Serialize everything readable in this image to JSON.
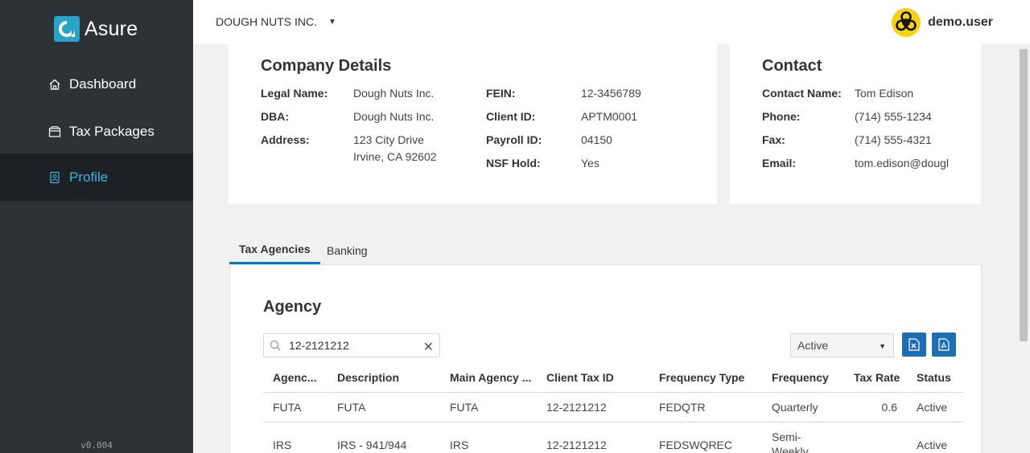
{
  "sidebar": {
    "brand": "Asure",
    "items": [
      {
        "label": "Dashboard",
        "icon": "home-icon"
      },
      {
        "label": "Tax Packages",
        "icon": "package-icon"
      },
      {
        "label": "Profile",
        "icon": "profile-icon"
      }
    ],
    "active_item": "Profile",
    "version": "v0.004"
  },
  "header": {
    "company": "DOUGH NUTS INC.",
    "username": "demo.user",
    "avatar_icon": "biohazard-icon"
  },
  "company_details": {
    "title": "Company Details",
    "legal_name_label": "Legal Name:",
    "legal_name": "Dough Nuts Inc.",
    "dba_label": "DBA:",
    "dba": "Dough Nuts Inc.",
    "address_label": "Address:",
    "address_line1": "123 City Drive",
    "address_line2": "Irvine, CA 92602",
    "fein_label": "FEIN:",
    "fein": "12-3456789",
    "client_id_label": "Client ID:",
    "client_id": "APTM0001",
    "payroll_id_label": "Payroll ID:",
    "payroll_id": "04150",
    "nsf_hold_label": "NSF Hold:",
    "nsf_hold": "Yes"
  },
  "contact": {
    "title": "Contact",
    "name_label": "Contact Name:",
    "name": "Tom Edison",
    "phone_label": "Phone:",
    "phone": "(714) 555-1234",
    "fax_label": "Fax:",
    "fax": "(714) 555-4321",
    "email_label": "Email:",
    "email": "tom.edison@dougl"
  },
  "tabs": [
    {
      "label": "Tax Agencies",
      "active": true
    },
    {
      "label": "Banking",
      "active": false
    }
  ],
  "agency": {
    "title": "Agency",
    "search_value": "12-2121212",
    "status_filter": "Active",
    "columns": [
      "Agenc...",
      "Description",
      "Main Agency ...",
      "Client Tax ID",
      "Frequency Type",
      "Frequency",
      "Tax Rate",
      "Status"
    ],
    "rows": [
      {
        "agency": "FUTA",
        "description": "FUTA",
        "main_agency": "FUTA",
        "client_tax_id": "12-2121212",
        "frequency_type": "FEDQTR",
        "frequency": "Quarterly",
        "tax_rate": "0.6",
        "status": "Active"
      },
      {
        "agency": "IRS",
        "description": "IRS - 941/944",
        "main_agency": "IRS",
        "client_tax_id": "12-2121212",
        "frequency_type": "FEDSWQREC",
        "frequency_line1": "Semi-",
        "frequency_line2": "Weekly",
        "tax_rate": "",
        "status": "Active"
      }
    ]
  },
  "colors": {
    "sidebar_bg": "#2d3237",
    "sidebar_active_bg": "#1c2125",
    "accent": "#3bb8d9",
    "primary_button": "#1d6fb2"
  }
}
